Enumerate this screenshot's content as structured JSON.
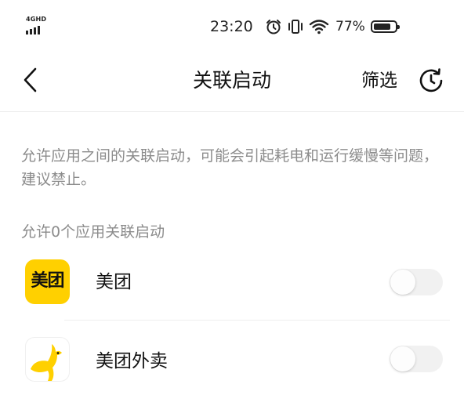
{
  "status_bar": {
    "network": "4GHD",
    "time": "23:20",
    "battery_percent": "77%",
    "icons": [
      "alarm-icon",
      "vibrate-icon",
      "wifi-icon",
      "battery-icon"
    ]
  },
  "header": {
    "title": "关联启动",
    "filter_label": "筛选",
    "back_icon": "back-arrow-icon",
    "history_icon": "history-clock-icon"
  },
  "description": "允许应用之间的关联启动，可能会引起耗电和运行缓慢等问题，建议禁止。",
  "section": {
    "label": "允许0个应用关联启动"
  },
  "apps": [
    {
      "name": "美团",
      "icon_text": "美团",
      "icon_color": "#FFD000",
      "enabled": false
    },
    {
      "name": "美团外卖",
      "icon_color": "#FFD000",
      "enabled": false
    }
  ],
  "colors": {
    "accent_yellow": "#FFD000",
    "secondary_text": "#8c8c8c",
    "toggle_off": "#f1f1f1"
  }
}
